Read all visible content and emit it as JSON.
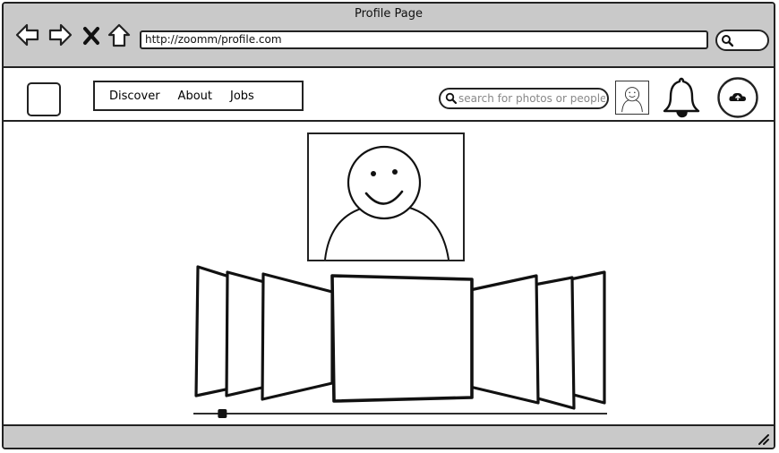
{
  "window": {
    "title": "Profile Page"
  },
  "browser": {
    "url": "http://zoomm/profile.com",
    "back_icon": "back-arrow-icon",
    "forward_icon": "forward-arrow-icon",
    "stop_icon": "close-icon",
    "home_icon": "home-icon"
  },
  "nav": {
    "items": [
      {
        "label": "Discover"
      },
      {
        "label": "About"
      },
      {
        "label": "Jobs"
      }
    ]
  },
  "search": {
    "placeholder": "search for photos or people",
    "value": ""
  },
  "icons": {
    "notifications": "bell-icon",
    "upload": "cloud-upload-icon",
    "user": "user-avatar-icon"
  },
  "gallery": {
    "slider_position": 0.07
  },
  "colors": {
    "chrome": "#c9c9c9",
    "stroke": "#222222"
  }
}
